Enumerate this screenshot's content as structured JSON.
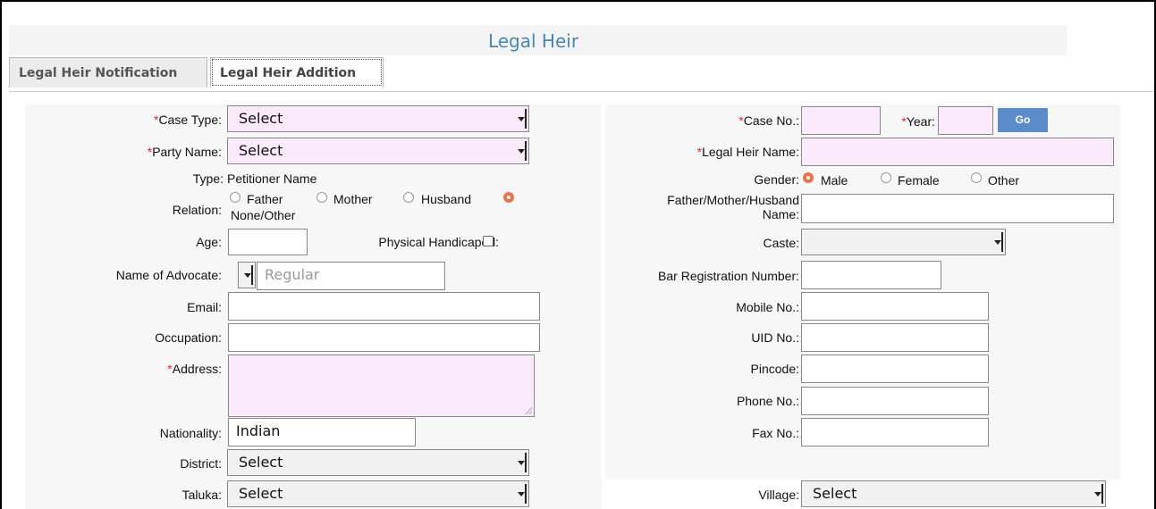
{
  "page": {
    "title": "Legal Heir"
  },
  "tabs": [
    {
      "label": "Legal Heir Notification"
    },
    {
      "label": "Legal Heir Addition"
    }
  ],
  "left": {
    "case_type": {
      "label": "Case Type:",
      "value": "Select"
    },
    "party_name": {
      "label": "Party Name:",
      "value": "Select"
    },
    "type": {
      "label": "Type:",
      "value": "Petitioner Name"
    },
    "relation": {
      "label": "Relation:",
      "options": [
        "Father",
        "Mother",
        "Husband",
        "None/Other"
      ],
      "selected": "None/Other"
    },
    "age": {
      "label": "Age:",
      "value": ""
    },
    "physical_handicaped": {
      "label": "Physical Handicaped:",
      "checked": false
    },
    "advocate": {
      "label": "Name of Advocate:",
      "placeholder": "Regular"
    },
    "email": {
      "label": "Email:",
      "value": ""
    },
    "occupation": {
      "label": "Occupation:",
      "value": ""
    },
    "address": {
      "label": "Address:",
      "value": ""
    },
    "nationality": {
      "label": "Nationality:",
      "value": "Indian"
    },
    "district": {
      "label": "District:",
      "value": "Select"
    },
    "taluka": {
      "label": "Taluka:",
      "value": "Select"
    }
  },
  "right": {
    "case_no": {
      "label": "Case No.:",
      "value": ""
    },
    "year": {
      "label": "Year:",
      "value": ""
    },
    "go_label": "Go",
    "legal_heir_name": {
      "label": "Legal Heir Name:",
      "value": ""
    },
    "gender": {
      "label": "Gender:",
      "options": [
        "Male",
        "Female",
        "Other"
      ],
      "selected": "Male"
    },
    "fmh_name": {
      "label_line1": "Father/Mother/Husband",
      "label_line2": "Name:",
      "value": ""
    },
    "caste": {
      "label": "Caste:",
      "value": ""
    },
    "bar_registration": {
      "label": "Bar Registration Number:",
      "value": ""
    },
    "mobile": {
      "label": "Mobile No.:",
      "value": ""
    },
    "uid": {
      "label": "UID No.:",
      "value": ""
    },
    "pincode": {
      "label": "Pincode:",
      "value": ""
    },
    "phone": {
      "label": "Phone No.:",
      "value": ""
    },
    "fax": {
      "label": "Fax No.:",
      "value": ""
    },
    "village": {
      "label": "Village:",
      "value": "Select"
    }
  },
  "required_mark": "*",
  "colors": {
    "required": "#e0282e",
    "title": "#4a86b0",
    "mandatory_bg": "#fbeafb",
    "go_button": "#5b8cc9",
    "radio_selected": "#e8754a"
  }
}
